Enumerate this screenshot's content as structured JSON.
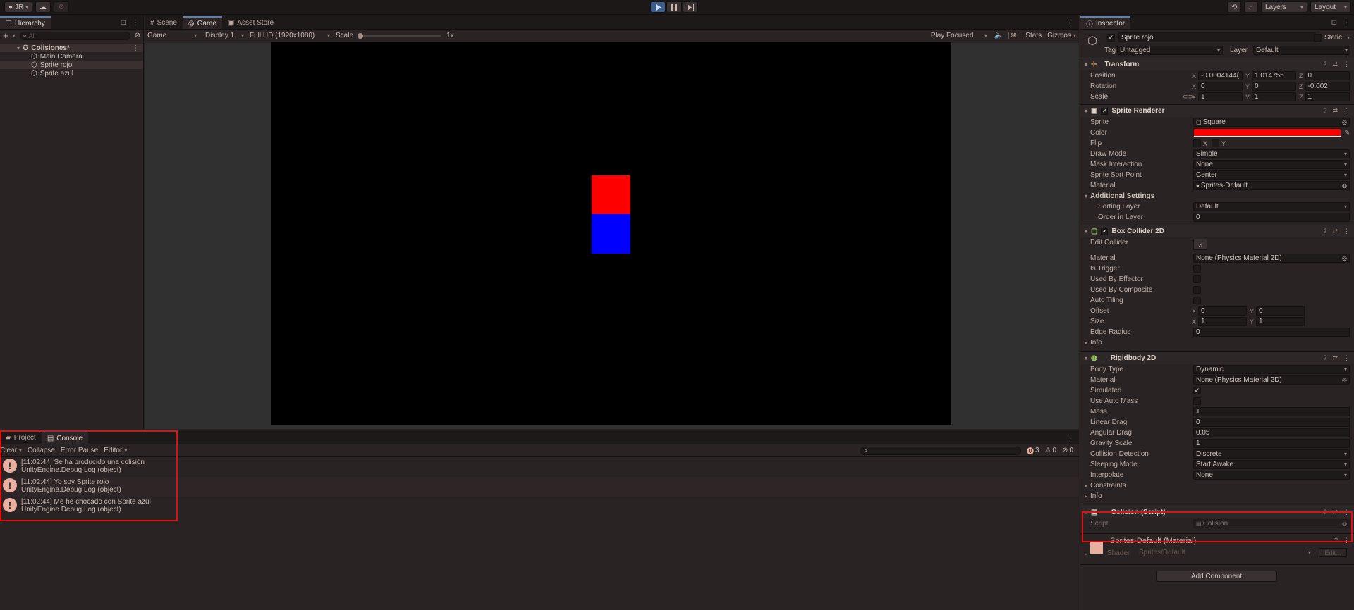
{
  "toolbar": {
    "account": "JR",
    "right": {
      "layers": "Layers",
      "layout": "Layout"
    }
  },
  "hierarchy": {
    "tab": "Hierarchy",
    "search_placeholder": "All",
    "scene": "Colisiones*",
    "items": [
      "Main Camera",
      "Sprite rojo",
      "Sprite azul"
    ]
  },
  "gameview": {
    "tabs": [
      "Scene",
      "Game",
      "Asset Store"
    ],
    "display_mode": "Game",
    "display": "Display 1",
    "resolution": "Full HD (1920x1080)",
    "scale_label": "Scale",
    "scale_value": "1x",
    "play_focused": "Play Focused",
    "stats": "Stats",
    "gizmos": "Gizmos",
    "sprite_top_color": "#ff0000",
    "sprite_bottom_color": "#0000ff"
  },
  "console": {
    "tabs": [
      "Project",
      "Console"
    ],
    "clear": "Clear",
    "collapse": "Collapse",
    "error_pause": "Error Pause",
    "editor": "Editor",
    "counts": {
      "logs": "3",
      "warnings": "0",
      "errors": "0"
    },
    "logs": [
      {
        "line1": "[11:02:44] Se ha producido una colisión",
        "line2": "UnityEngine.Debug:Log (object)"
      },
      {
        "line1": "[11:02:44] Yo soy Sprite rojo",
        "line2": "UnityEngine.Debug:Log (object)"
      },
      {
        "line1": "[11:02:44] Me he chocado con Sprite azul",
        "line2": "UnityEngine.Debug:Log (object)"
      }
    ]
  },
  "inspector": {
    "tab": "Inspector",
    "object_name": "Sprite rojo",
    "static_label": "Static",
    "tag_label": "Tag",
    "tag_value": "Untagged",
    "layer_label": "Layer",
    "layer_value": "Default",
    "transform": {
      "title": "Transform",
      "position_label": "Position",
      "position": [
        "-0.0004144(",
        "1.014755",
        "0"
      ],
      "rotation_label": "Rotation",
      "rotation": [
        "0",
        "0",
        "-0.002"
      ],
      "scale_label": "Scale",
      "scale": [
        "1",
        "1",
        "1"
      ]
    },
    "sprite_renderer": {
      "title": "Sprite Renderer",
      "sprite_label": "Sprite",
      "sprite": "Square",
      "color_label": "Color",
      "color": "#ff0000",
      "flip_label": "Flip",
      "flip_x": "X",
      "flip_y": "Y",
      "draw_mode_label": "Draw Mode",
      "draw_mode": "Simple",
      "mask_label": "Mask Interaction",
      "mask": "None",
      "sort_point_label": "Sprite Sort Point",
      "sort_point": "Center",
      "material_label": "Material",
      "material": "Sprites-Default",
      "additional": "Additional Settings",
      "sorting_layer_label": "Sorting Layer",
      "sorting_layer": "Default",
      "order_label": "Order in Layer",
      "order": "0"
    },
    "box_collider": {
      "title": "Box Collider 2D",
      "edit_label": "Edit Collider",
      "material_label": "Material",
      "material": "None (Physics Material 2D)",
      "trigger_label": "Is Trigger",
      "effector_label": "Used By Effector",
      "composite_label": "Used By Composite",
      "tiling_label": "Auto Tiling",
      "offset_label": "Offset",
      "offset": [
        "0",
        "0"
      ],
      "size_label": "Size",
      "size": [
        "1",
        "1"
      ],
      "edge_label": "Edge Radius",
      "edge": "0",
      "info": "Info"
    },
    "rigidbody": {
      "title": "Rigidbody 2D",
      "body_label": "Body Type",
      "body": "Dynamic",
      "material_label": "Material",
      "material": "None (Physics Material 2D)",
      "simulated_label": "Simulated",
      "auto_mass_label": "Use Auto Mass",
      "mass_label": "Mass",
      "mass": "1",
      "linear_label": "Linear Drag",
      "linear": "0",
      "angular_label": "Angular Drag",
      "angular": "0.05",
      "gravity_label": "Gravity Scale",
      "gravity": "1",
      "collision_label": "Collision Detection",
      "collision": "Discrete",
      "sleep_label": "Sleeping Mode",
      "sleep": "Start Awake",
      "interp_label": "Interpolate",
      "interp": "None",
      "constraints": "Constraints",
      "info": "Info"
    },
    "script": {
      "title": "Colision (Script)",
      "script_label": "Script",
      "script": "Colision"
    },
    "material": {
      "title": "Sprites-Default (Material)",
      "shader_label": "Shader",
      "shader": "Sprites/Default",
      "edit": "Edit..."
    },
    "add_component": "Add Component"
  }
}
